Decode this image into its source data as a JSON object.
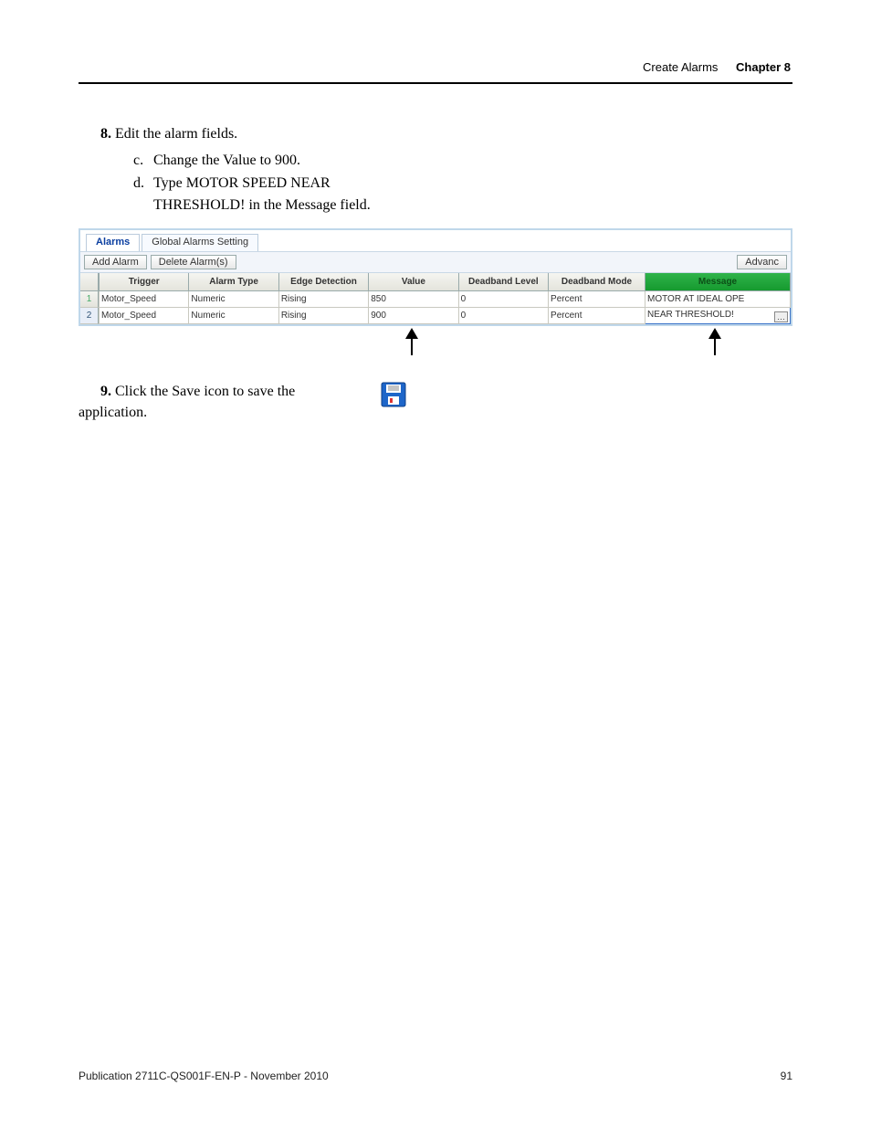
{
  "header": {
    "breadcrumb": "Create Alarms",
    "chapter": "Chapter 8"
  },
  "steps": {
    "s8": {
      "num": "8.",
      "text": "Edit the alarm fields.",
      "c_letter": "c.",
      "c_text": "Change the Value to 900.",
      "d_letter": "d.",
      "d_text": "Type MOTOR SPEED NEAR THRESHOLD! in the Message field."
    },
    "s9": {
      "num": "9.",
      "text": "Click the Save icon to save the application."
    }
  },
  "panel": {
    "tab_alarms": "Alarms",
    "tab_global": "Global Alarms Setting",
    "btn_add": "Add Alarm",
    "btn_delete": "Delete Alarm(s)",
    "btn_advanced": "Advanc",
    "cols": {
      "trigger": "Trigger",
      "alarm_type": "Alarm Type",
      "edge": "Edge Detection",
      "value": "Value",
      "db_level": "Deadband Level",
      "db_mode": "Deadband Mode",
      "message": "Message"
    },
    "rows": [
      {
        "idx": "1",
        "trigger": "Motor_Speed",
        "alarm_type": "Numeric",
        "edge": "Rising",
        "value": "850",
        "db_level": "0",
        "db_mode": "Percent",
        "message": "MOTOR AT IDEAL OPE"
      },
      {
        "idx": "2",
        "trigger": "Motor_Speed",
        "alarm_type": "Numeric",
        "edge": "Rising",
        "value": "900",
        "db_level": "0",
        "db_mode": "Percent",
        "message": "NEAR THRESHOLD!"
      }
    ]
  },
  "footer": {
    "pub": "Publication 2711C-QS001F-EN-P - November 2010",
    "page": "91"
  }
}
